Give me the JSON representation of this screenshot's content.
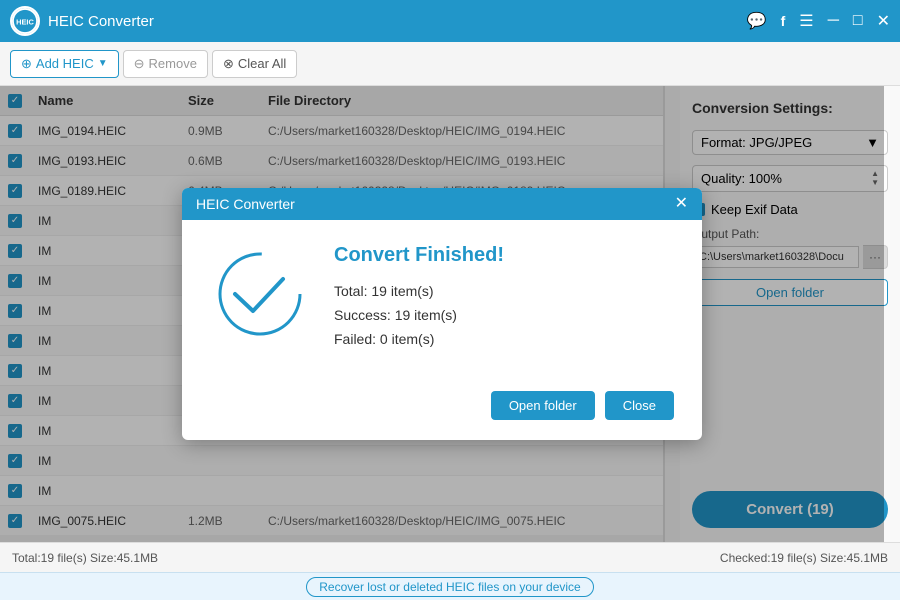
{
  "titleBar": {
    "logo": "HEIC",
    "title": "HEIC Converter",
    "icons": [
      "chat-icon",
      "facebook-icon",
      "menu-icon",
      "minimize-icon",
      "maximize-icon",
      "close-icon"
    ]
  },
  "toolbar": {
    "addLabel": "Add HEIC",
    "removeLabel": "Remove",
    "clearAllLabel": "Clear All"
  },
  "fileList": {
    "columns": {
      "name": "Name",
      "size": "Size",
      "directory": "File Directory"
    },
    "files": [
      {
        "name": "IMG_0194.HEIC",
        "size": "0.9MB",
        "dir": "C:/Users/market160328/Desktop/HEIC/IMG_0194.HEIC"
      },
      {
        "name": "IMG_0193.HEIC",
        "size": "0.6MB",
        "dir": "C:/Users/market160328/Desktop/HEIC/IMG_0193.HEIC"
      },
      {
        "name": "IMG_0189.HEIC",
        "size": "6.4MB",
        "dir": "C:/Users/market160328/Desktop/HEIC/IMG_0189.HEIC"
      },
      {
        "name": "IM",
        "size": "",
        "dir": ""
      },
      {
        "name": "IM",
        "size": "",
        "dir": ""
      },
      {
        "name": "IM",
        "size": "",
        "dir": ""
      },
      {
        "name": "IM",
        "size": "",
        "dir": ""
      },
      {
        "name": "IM",
        "size": "",
        "dir": ""
      },
      {
        "name": "IM",
        "size": "",
        "dir": ""
      },
      {
        "name": "IM",
        "size": "",
        "dir": ""
      },
      {
        "name": "IM",
        "size": "",
        "dir": ""
      },
      {
        "name": "IM",
        "size": "",
        "dir": ""
      },
      {
        "name": "IM",
        "size": "",
        "dir": ""
      },
      {
        "name": "IMG_0075.HEIC",
        "size": "1.2MB",
        "dir": "C:/Users/market160328/Desktop/HEIC/IMG_0075.HEIC"
      }
    ]
  },
  "settings": {
    "title": "Conversion Settings:",
    "formatLabel": "Format: JPG/JPEG",
    "qualityLabel": "Quality: 100%",
    "keepExif": "Keep Exif Data",
    "outputPathLabel": "Output Path:",
    "outputPath": "C:\\Users\\market160328\\Docu",
    "openFolderLabel": "Open folder",
    "convertLabel": "Convert (19)"
  },
  "statusBar": {
    "left": "Total:19 file(s) Size:45.1MB",
    "right": "Checked:19 file(s) Size:45.1MB"
  },
  "bottomBar": {
    "recoverLink": "Recover lost or deleted HEIC files on your device"
  },
  "modal": {
    "title": "HEIC Converter",
    "finishedTitle": "Convert Finished!",
    "total": "Total: 19 item(s)",
    "success": "Success: 19 item(s)",
    "failed": "Failed: 0 item(s)",
    "openFolderLabel": "Open folder",
    "closeLabel": "Close"
  }
}
